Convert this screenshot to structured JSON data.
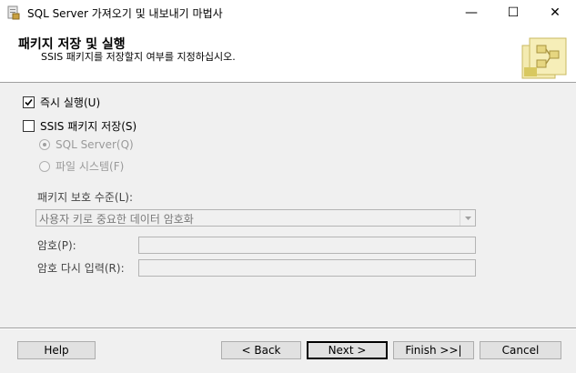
{
  "window": {
    "title": "SQL Server 가져오기 및 내보내기 마법사",
    "minimize_glyph": "—",
    "maximize_glyph": "☐",
    "close_glyph": "✕"
  },
  "header": {
    "title": "패키지 저장 및 실행",
    "subtitle": "SSIS 패키지를 저장할지 여부를 지정하십시오.",
    "logo_icon": "package-wizard-icon"
  },
  "options": {
    "run_immediately": {
      "label": "즉시 실행(U)",
      "checked": true
    },
    "save_ssis_package": {
      "label": "SSIS 패키지 저장(S)",
      "checked": false
    },
    "location_sql_server": {
      "label": "SQL Server(Q)",
      "selected": true,
      "enabled": false
    },
    "location_file_system": {
      "label": "파일 시스템(F)",
      "selected": false,
      "enabled": false
    }
  },
  "protection": {
    "label": "패키지 보호 수준(L):",
    "value": "사용자 키로 중요한 데이터 암호화"
  },
  "password": {
    "label": "암호(P):",
    "value": ""
  },
  "password_confirm": {
    "label": "암호 다시 입력(R):",
    "value": ""
  },
  "buttons": {
    "help": "Help",
    "back": "< Back",
    "next": "Next >",
    "finish": "Finish >>|",
    "cancel": "Cancel"
  }
}
